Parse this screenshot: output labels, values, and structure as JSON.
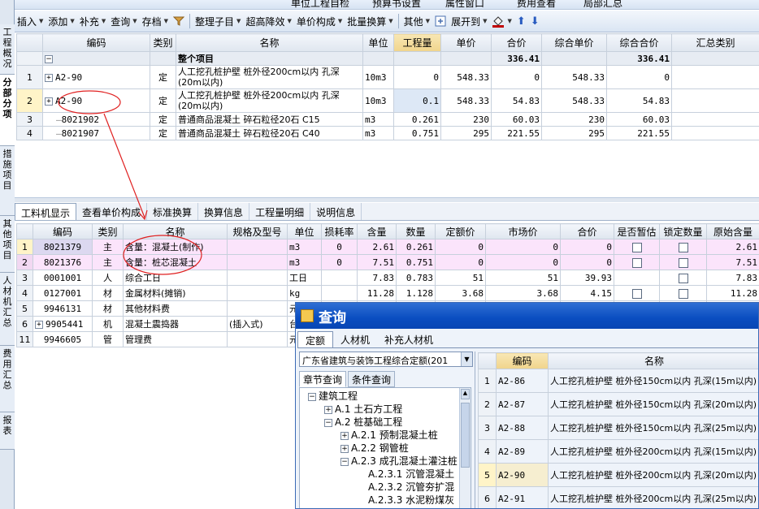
{
  "toolbar_top": {
    "items": [
      "单位工程自检",
      "预算书设置",
      "属性窗口",
      "费用查看",
      "局部汇总"
    ]
  },
  "toolbar": {
    "items": [
      "插入",
      "添加",
      "补充",
      "查询",
      "存档",
      "整理子目",
      "超高降效",
      "单价构成",
      "批量换算",
      "其他",
      "展开到"
    ]
  },
  "left_tabs": [
    "工程概况",
    "分部分项",
    "措施项目",
    "其他项目",
    "人材机汇总",
    "费用汇总",
    "报表"
  ],
  "main_table": {
    "headers": [
      "编码",
      "类别",
      "名称",
      "单位",
      "工程量",
      "单价",
      "合价",
      "综合单价",
      "综合合价",
      "汇总类别"
    ],
    "group_row": {
      "name": "整个项目",
      "total": "336.41",
      "total2": "336.41"
    },
    "rows": [
      {
        "idx": "1",
        "code": "A2-90",
        "type": "定",
        "name": "人工挖孔桩护壁 桩外径200cm以内 孔深(20m以内)",
        "unit": "10m3",
        "qty": "0",
        "price": "548.33",
        "amount": "0",
        "unit_total": "548.33",
        "total": "0"
      },
      {
        "idx": "2",
        "code": "A2-90",
        "type": "定",
        "name": "人工挖孔桩护壁 桩外径200cm以内 孔深(20m以内)",
        "unit": "10m3",
        "qty": "0.1",
        "price": "548.33",
        "amount": "54.83",
        "unit_total": "548.33",
        "total": "54.83"
      },
      {
        "idx": "3",
        "code": "8021902",
        "type": "定",
        "name": "普通商品混凝土 碎石粒径20石 C15",
        "unit": "m3",
        "qty": "0.261",
        "price": "230",
        "amount": "60.03",
        "unit_total": "230",
        "total": "60.03"
      },
      {
        "idx": "4",
        "code": "8021907",
        "type": "定",
        "name": "普通商品混凝土 碎石粒径20石 C40",
        "unit": "m3",
        "qty": "0.751",
        "price": "295",
        "amount": "221.55",
        "unit_total": "295",
        "total": "221.55"
      }
    ]
  },
  "bottom_tabs": [
    "工料机显示",
    "查看单价构成",
    "标准换算",
    "换算信息",
    "工程量明细",
    "说明信息"
  ],
  "res_table": {
    "headers": [
      "编码",
      "类别",
      "名称",
      "规格及型号",
      "单位",
      "损耗率",
      "含量",
      "数量",
      "定额价",
      "市场价",
      "合价",
      "是否暂估",
      "锁定数量",
      "原始含量"
    ],
    "rows": [
      {
        "idx": "1",
        "code": "8021379",
        "type": "主",
        "name": "含量：混凝土(制作)",
        "spec": "",
        "unit": "m3",
        "loss": "0",
        "content": "2.61",
        "qty": "0.261",
        "quota": "0",
        "market": "0",
        "amount": "0",
        "orig": "2.61"
      },
      {
        "idx": "2",
        "code": "8021376",
        "type": "主",
        "name": "含量：桩芯混凝土",
        "spec": "",
        "unit": "m3",
        "loss": "0",
        "content": "7.51",
        "qty": "0.751",
        "quota": "0",
        "market": "0",
        "amount": "0",
        "orig": "7.51"
      },
      {
        "idx": "3",
        "code": "0001001",
        "type": "人",
        "name": "综合工日",
        "spec": "",
        "unit": "工日",
        "loss": "",
        "content": "7.83",
        "qty": "0.783",
        "quota": "51",
        "market": "51",
        "amount": "39.93",
        "orig": "7.83"
      },
      {
        "idx": "4",
        "code": "0127001",
        "type": "材",
        "name": "金属材料(摊销)",
        "spec": "",
        "unit": "kg",
        "loss": "",
        "content": "11.28",
        "qty": "1.128",
        "quota": "3.68",
        "market": "3.68",
        "amount": "4.15",
        "orig": "11.28"
      },
      {
        "idx": "5",
        "code": "9946131",
        "type": "材",
        "name": "其他材料费",
        "spec": "",
        "unit": "元",
        "loss": "",
        "content": "",
        "qty": "",
        "quota": "",
        "market": "",
        "amount": "",
        "orig": ""
      },
      {
        "idx": "6",
        "code": "9905441",
        "type": "机",
        "name": "混凝土震捣器",
        "spec": "(插入式)",
        "unit": "台",
        "loss": "",
        "content": "",
        "qty": "",
        "quota": "",
        "market": "",
        "amount": "",
        "orig": ""
      },
      {
        "idx": "11",
        "code": "9946605",
        "type": "管",
        "name": "管理费",
        "spec": "",
        "unit": "元",
        "loss": "",
        "content": "",
        "qty": "",
        "quota": "",
        "market": "",
        "amount": "",
        "orig": ""
      }
    ]
  },
  "dialog": {
    "title": "查询",
    "tabs": [
      "定额",
      "人材机",
      "补充人材机"
    ],
    "combo_value": "广东省建筑与装饰工程综合定额(201",
    "subtabs": [
      "章节查询",
      "条件查询"
    ],
    "tree": [
      "建筑工程",
      "A.1 土石方工程",
      "A.2 桩基础工程",
      "A.2.1 预制混凝土桩",
      "A.2.2 钢管桩",
      "A.2.3 成孔混凝土灌注桩",
      "A.2.3.1 沉管混凝土",
      "A.2.3.2 沉管夯扩混",
      "A.2.3.3 水泥粉煤灰"
    ],
    "list_headers": [
      "编码",
      "名称"
    ],
    "list_rows": [
      {
        "idx": "1",
        "code": "A2-86",
        "name": "人工挖孔桩护壁 桩外径150cm以内 孔深(15m以内)"
      },
      {
        "idx": "2",
        "code": "A2-87",
        "name": "人工挖孔桩护壁 桩外径150cm以内 孔深(20m以内)"
      },
      {
        "idx": "3",
        "code": "A2-88",
        "name": "人工挖孔桩护壁 桩外径150cm以内 孔深(25m以内)"
      },
      {
        "idx": "4",
        "code": "A2-89",
        "name": "人工挖孔桩护壁 桩外径200cm以内 孔深(15m以内)"
      },
      {
        "idx": "5",
        "code": "A2-90",
        "name": "人工挖孔桩护壁 桩外径200cm以内 孔深(20m以内)"
      },
      {
        "idx": "6",
        "code": "A2-91",
        "name": "人工挖孔桩护壁 桩外径200cm以内 孔深(25m以内)"
      }
    ]
  },
  "colors": {
    "selected_cell": "#fff4c8",
    "pink_row": "#fbe4fb",
    "annotation": "#e02020",
    "dialog_title": "#0a4dc0"
  }
}
